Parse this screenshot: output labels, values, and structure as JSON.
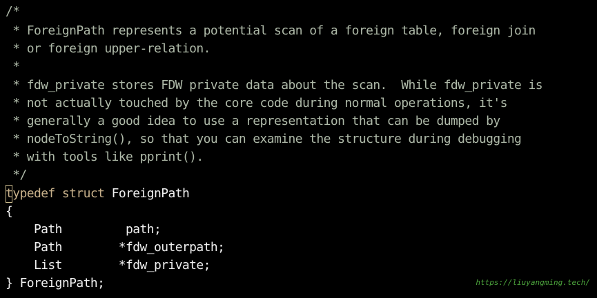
{
  "editor": {
    "comment_lines": [
      "/*",
      " * ForeignPath represents a potential scan of a foreign table, foreign join",
      " * or foreign upper-relation.",
      " *",
      " * fdw_private stores FDW private data about the scan.  While fdw_private is",
      " * not actually touched by the core code during normal operations, it's",
      " * generally a good idea to use a representation that can be dumped by",
      " * nodeToString(), so that you can examine the structure during debugging",
      " * with tools like pprint().",
      " */"
    ],
    "cursor_char": "t",
    "typedef_rest": "ypedef",
    "struct_kw": " struct",
    "struct_name": " ForeignPath",
    "open_brace": "{",
    "fields": [
      {
        "type": "    Path",
        "name": "         path;"
      },
      {
        "type": "    Path",
        "name": "        *fdw_outerpath;"
      },
      {
        "type": "    List",
        "name": "        *fdw_private;"
      }
    ],
    "close_line": "} ForeignPath;"
  },
  "watermark": "https://liuyangming.tech/",
  "colors": {
    "background": "#000000",
    "comment": "#aeb9a8",
    "keyword": "#c7b08a",
    "text": "#f0f0f0",
    "watermark": "#4ea83e"
  }
}
